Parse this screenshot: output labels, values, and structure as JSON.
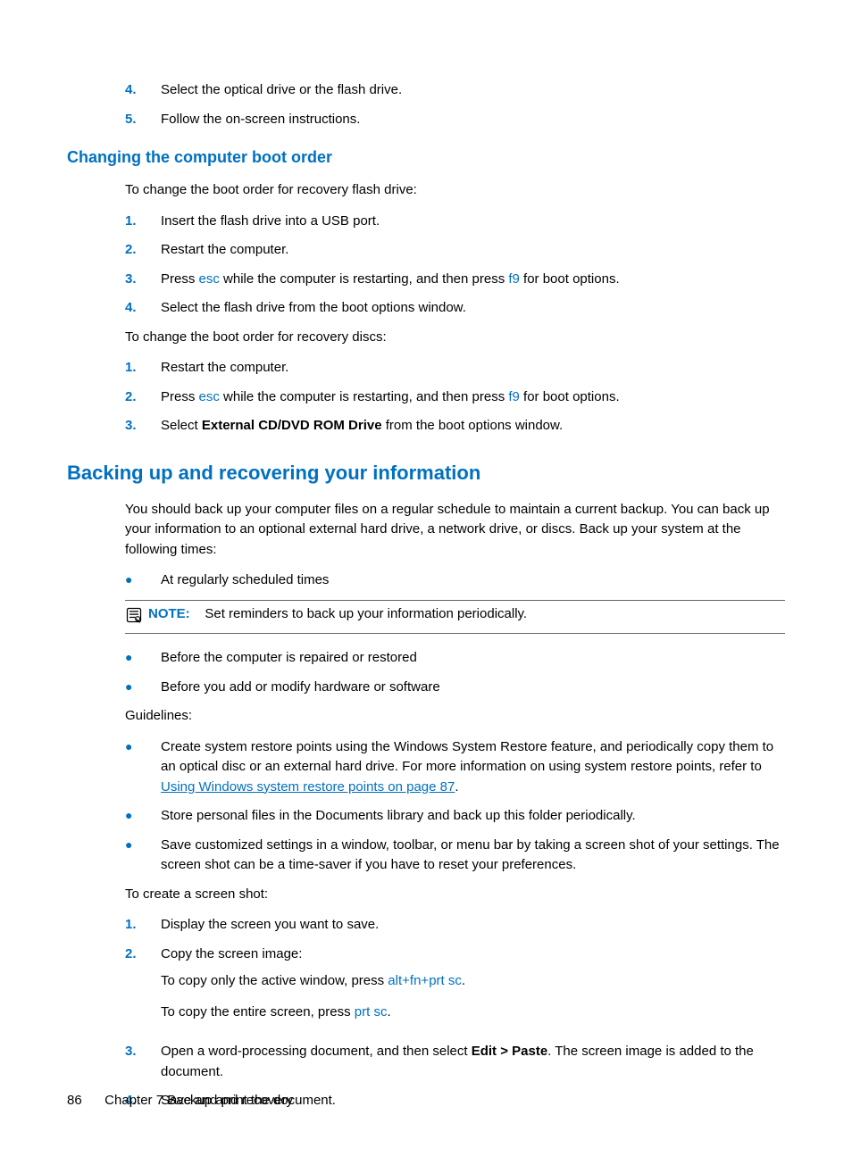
{
  "top_list": {
    "items": [
      {
        "num": "4.",
        "text": "Select the optical drive or the flash drive."
      },
      {
        "num": "5.",
        "text": "Follow the on-screen instructions."
      }
    ]
  },
  "h2_boot": "Changing the computer boot order",
  "boot": {
    "intro_flash": "To change the boot order for recovery flash drive:",
    "flash_list": [
      {
        "num": "1.",
        "text": "Insert the flash drive into a USB port."
      },
      {
        "num": "2.",
        "text": "Restart the computer."
      },
      {
        "num": "3.",
        "pre": "Press ",
        "k1": "esc",
        "mid": " while the computer is restarting, and then press ",
        "k2": "f9",
        "post": " for boot options."
      },
      {
        "num": "4.",
        "text": "Select the flash drive from the boot options window."
      }
    ],
    "intro_disc": "To change the boot order for recovery discs:",
    "disc_list": [
      {
        "num": "1.",
        "text": "Restart the computer."
      },
      {
        "num": "2.",
        "pre": "Press ",
        "k1": "esc",
        "mid": " while the computer is restarting, and then press ",
        "k2": "f9",
        "post": " for boot options."
      },
      {
        "num": "3.",
        "pre": "Select ",
        "bold": "External CD/DVD ROM Drive",
        "post": " from the boot options window."
      }
    ]
  },
  "h1_backup": "Backing up and recovering your information",
  "backup": {
    "intro": "You should back up your computer files on a regular schedule to maintain a current backup. You can back up your information to an optional external hard drive, a network drive, or discs. Back up your system at the following times:",
    "bullets1": [
      "At regularly scheduled times"
    ],
    "note_label": "NOTE:",
    "note_text": "Set reminders to back up your information periodically.",
    "bullets2": [
      "Before the computer is repaired or restored",
      "Before you add or modify hardware or software"
    ],
    "guidelines_label": "Guidelines:",
    "guideline_bullets": [
      {
        "pre": "Create system restore points using the Windows System Restore feature, and periodically copy them to an optical disc or an external hard drive. For more information on using system restore points, refer to ",
        "link": "Using Windows system restore points on page 87",
        "post": "."
      },
      {
        "text": "Store personal files in the Documents library and back up this folder periodically."
      },
      {
        "text": "Save customized settings in a window, toolbar, or menu bar by taking a screen shot of your settings. The screen shot can be a time-saver if you have to reset your preferences."
      }
    ],
    "screenshot_intro": "To create a screen shot:",
    "screenshot_list": [
      {
        "num": "1.",
        "text": "Display the screen you want to save."
      },
      {
        "num": "2.",
        "text": "Copy the screen image:",
        "sub": [
          {
            "pre": "To copy only the active window, press ",
            "k1": "alt",
            "p1": "+",
            "k2": "fn",
            "p2": "+",
            "k3": "prt sc",
            "post": "."
          },
          {
            "pre": "To copy the entire screen, press ",
            "k1": "prt sc",
            "post": "."
          }
        ]
      },
      {
        "num": "3.",
        "pre": "Open a word-processing document, and then select ",
        "bold": "Edit > Paste",
        "post": ". The screen image is added to the document."
      },
      {
        "num": "4.",
        "text": "Save and print the document."
      }
    ]
  },
  "footer": {
    "page": "86",
    "chapter": "Chapter 7   Backup and recovery"
  }
}
